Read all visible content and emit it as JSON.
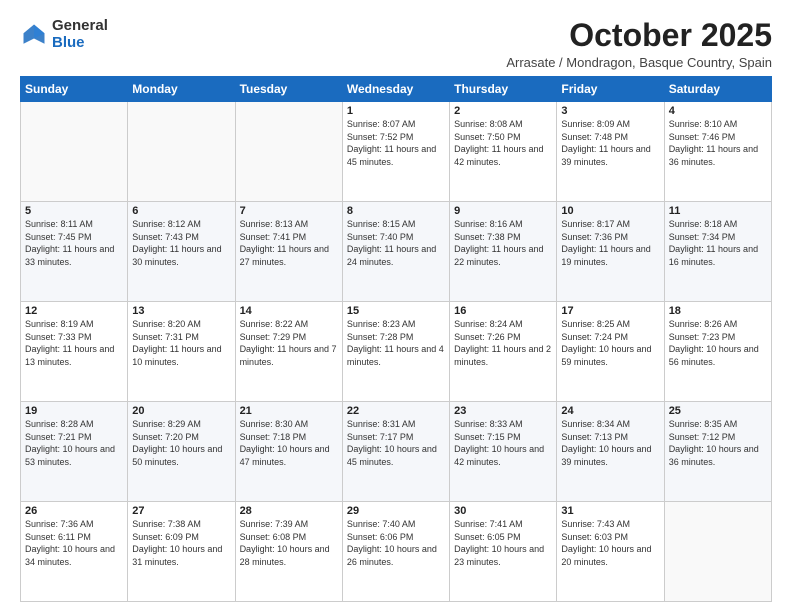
{
  "logo": {
    "general": "General",
    "blue": "Blue"
  },
  "header": {
    "month": "October 2025",
    "location": "Arrasate / Mondragon, Basque Country, Spain"
  },
  "weekdays": [
    "Sunday",
    "Monday",
    "Tuesday",
    "Wednesday",
    "Thursday",
    "Friday",
    "Saturday"
  ],
  "weeks": [
    [
      {
        "day": "",
        "info": ""
      },
      {
        "day": "",
        "info": ""
      },
      {
        "day": "",
        "info": ""
      },
      {
        "day": "1",
        "info": "Sunrise: 8:07 AM\nSunset: 7:52 PM\nDaylight: 11 hours and 45 minutes."
      },
      {
        "day": "2",
        "info": "Sunrise: 8:08 AM\nSunset: 7:50 PM\nDaylight: 11 hours and 42 minutes."
      },
      {
        "day": "3",
        "info": "Sunrise: 8:09 AM\nSunset: 7:48 PM\nDaylight: 11 hours and 39 minutes."
      },
      {
        "day": "4",
        "info": "Sunrise: 8:10 AM\nSunset: 7:46 PM\nDaylight: 11 hours and 36 minutes."
      }
    ],
    [
      {
        "day": "5",
        "info": "Sunrise: 8:11 AM\nSunset: 7:45 PM\nDaylight: 11 hours and 33 minutes."
      },
      {
        "day": "6",
        "info": "Sunrise: 8:12 AM\nSunset: 7:43 PM\nDaylight: 11 hours and 30 minutes."
      },
      {
        "day": "7",
        "info": "Sunrise: 8:13 AM\nSunset: 7:41 PM\nDaylight: 11 hours and 27 minutes."
      },
      {
        "day": "8",
        "info": "Sunrise: 8:15 AM\nSunset: 7:40 PM\nDaylight: 11 hours and 24 minutes."
      },
      {
        "day": "9",
        "info": "Sunrise: 8:16 AM\nSunset: 7:38 PM\nDaylight: 11 hours and 22 minutes."
      },
      {
        "day": "10",
        "info": "Sunrise: 8:17 AM\nSunset: 7:36 PM\nDaylight: 11 hours and 19 minutes."
      },
      {
        "day": "11",
        "info": "Sunrise: 8:18 AM\nSunset: 7:34 PM\nDaylight: 11 hours and 16 minutes."
      }
    ],
    [
      {
        "day": "12",
        "info": "Sunrise: 8:19 AM\nSunset: 7:33 PM\nDaylight: 11 hours and 13 minutes."
      },
      {
        "day": "13",
        "info": "Sunrise: 8:20 AM\nSunset: 7:31 PM\nDaylight: 11 hours and 10 minutes."
      },
      {
        "day": "14",
        "info": "Sunrise: 8:22 AM\nSunset: 7:29 PM\nDaylight: 11 hours and 7 minutes."
      },
      {
        "day": "15",
        "info": "Sunrise: 8:23 AM\nSunset: 7:28 PM\nDaylight: 11 hours and 4 minutes."
      },
      {
        "day": "16",
        "info": "Sunrise: 8:24 AM\nSunset: 7:26 PM\nDaylight: 11 hours and 2 minutes."
      },
      {
        "day": "17",
        "info": "Sunrise: 8:25 AM\nSunset: 7:24 PM\nDaylight: 10 hours and 59 minutes."
      },
      {
        "day": "18",
        "info": "Sunrise: 8:26 AM\nSunset: 7:23 PM\nDaylight: 10 hours and 56 minutes."
      }
    ],
    [
      {
        "day": "19",
        "info": "Sunrise: 8:28 AM\nSunset: 7:21 PM\nDaylight: 10 hours and 53 minutes."
      },
      {
        "day": "20",
        "info": "Sunrise: 8:29 AM\nSunset: 7:20 PM\nDaylight: 10 hours and 50 minutes."
      },
      {
        "day": "21",
        "info": "Sunrise: 8:30 AM\nSunset: 7:18 PM\nDaylight: 10 hours and 47 minutes."
      },
      {
        "day": "22",
        "info": "Sunrise: 8:31 AM\nSunset: 7:17 PM\nDaylight: 10 hours and 45 minutes."
      },
      {
        "day": "23",
        "info": "Sunrise: 8:33 AM\nSunset: 7:15 PM\nDaylight: 10 hours and 42 minutes."
      },
      {
        "day": "24",
        "info": "Sunrise: 8:34 AM\nSunset: 7:13 PM\nDaylight: 10 hours and 39 minutes."
      },
      {
        "day": "25",
        "info": "Sunrise: 8:35 AM\nSunset: 7:12 PM\nDaylight: 10 hours and 36 minutes."
      }
    ],
    [
      {
        "day": "26",
        "info": "Sunrise: 7:36 AM\nSunset: 6:11 PM\nDaylight: 10 hours and 34 minutes."
      },
      {
        "day": "27",
        "info": "Sunrise: 7:38 AM\nSunset: 6:09 PM\nDaylight: 10 hours and 31 minutes."
      },
      {
        "day": "28",
        "info": "Sunrise: 7:39 AM\nSunset: 6:08 PM\nDaylight: 10 hours and 28 minutes."
      },
      {
        "day": "29",
        "info": "Sunrise: 7:40 AM\nSunset: 6:06 PM\nDaylight: 10 hours and 26 minutes."
      },
      {
        "day": "30",
        "info": "Sunrise: 7:41 AM\nSunset: 6:05 PM\nDaylight: 10 hours and 23 minutes."
      },
      {
        "day": "31",
        "info": "Sunrise: 7:43 AM\nSunset: 6:03 PM\nDaylight: 10 hours and 20 minutes."
      },
      {
        "day": "",
        "info": ""
      }
    ]
  ]
}
